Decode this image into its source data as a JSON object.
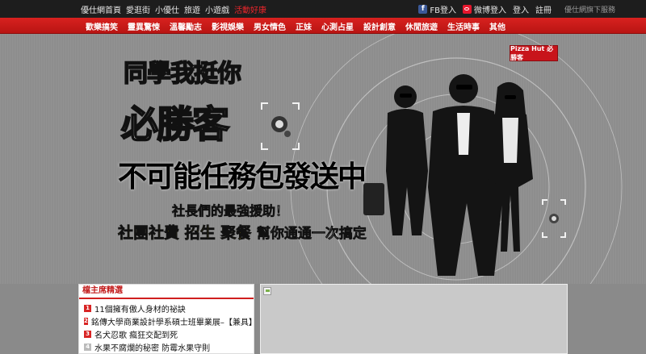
{
  "topbar": {
    "nav": [
      "優仕網首頁",
      "愛逛街",
      "小優仕",
      "旅遊",
      "小遊戲"
    ],
    "hot": "活動好康",
    "fb_login": "FB登入",
    "weibo_login": "微博登入",
    "login": "登入",
    "register": "註冊",
    "service": "優仕網旗下服務"
  },
  "categories": [
    "歡樂搞笑",
    "靈異驚悚",
    "溫馨勵志",
    "影視娛樂",
    "男女情色",
    "正妹",
    "心測占星",
    "設計創意",
    "休閒旅遊",
    "生活時事",
    "其他"
  ],
  "banner": {
    "logo": "Pizza Hut 必勝客",
    "headline1": "同學我挺你",
    "headline2": "必勝客",
    "headline3": "不可能任務包發送中",
    "sub1": "社長們的最強援助！",
    "sub2_a": "社團社費",
    "sub2_b": "招生",
    "sub2_c": "聚餐",
    "sub2_d": "幫你通通一次搞定"
  },
  "sidebox": {
    "title": "檔主席精選",
    "items": [
      {
        "num": "1",
        "text": "11個擁有傲人身材的祕訣"
      },
      {
        "num": "2",
        "text": "銘傳大學商業設計學系碩士班畢業展–【兼具】"
      },
      {
        "num": "3",
        "text": "名犬忍歌 瘋狂交配到死"
      },
      {
        "num": "4",
        "text": "水果不腐爛的秘密 防霉水果守則"
      }
    ]
  },
  "colors": {
    "accent": "#d01f1f",
    "topbar": "#1d1d1d"
  }
}
